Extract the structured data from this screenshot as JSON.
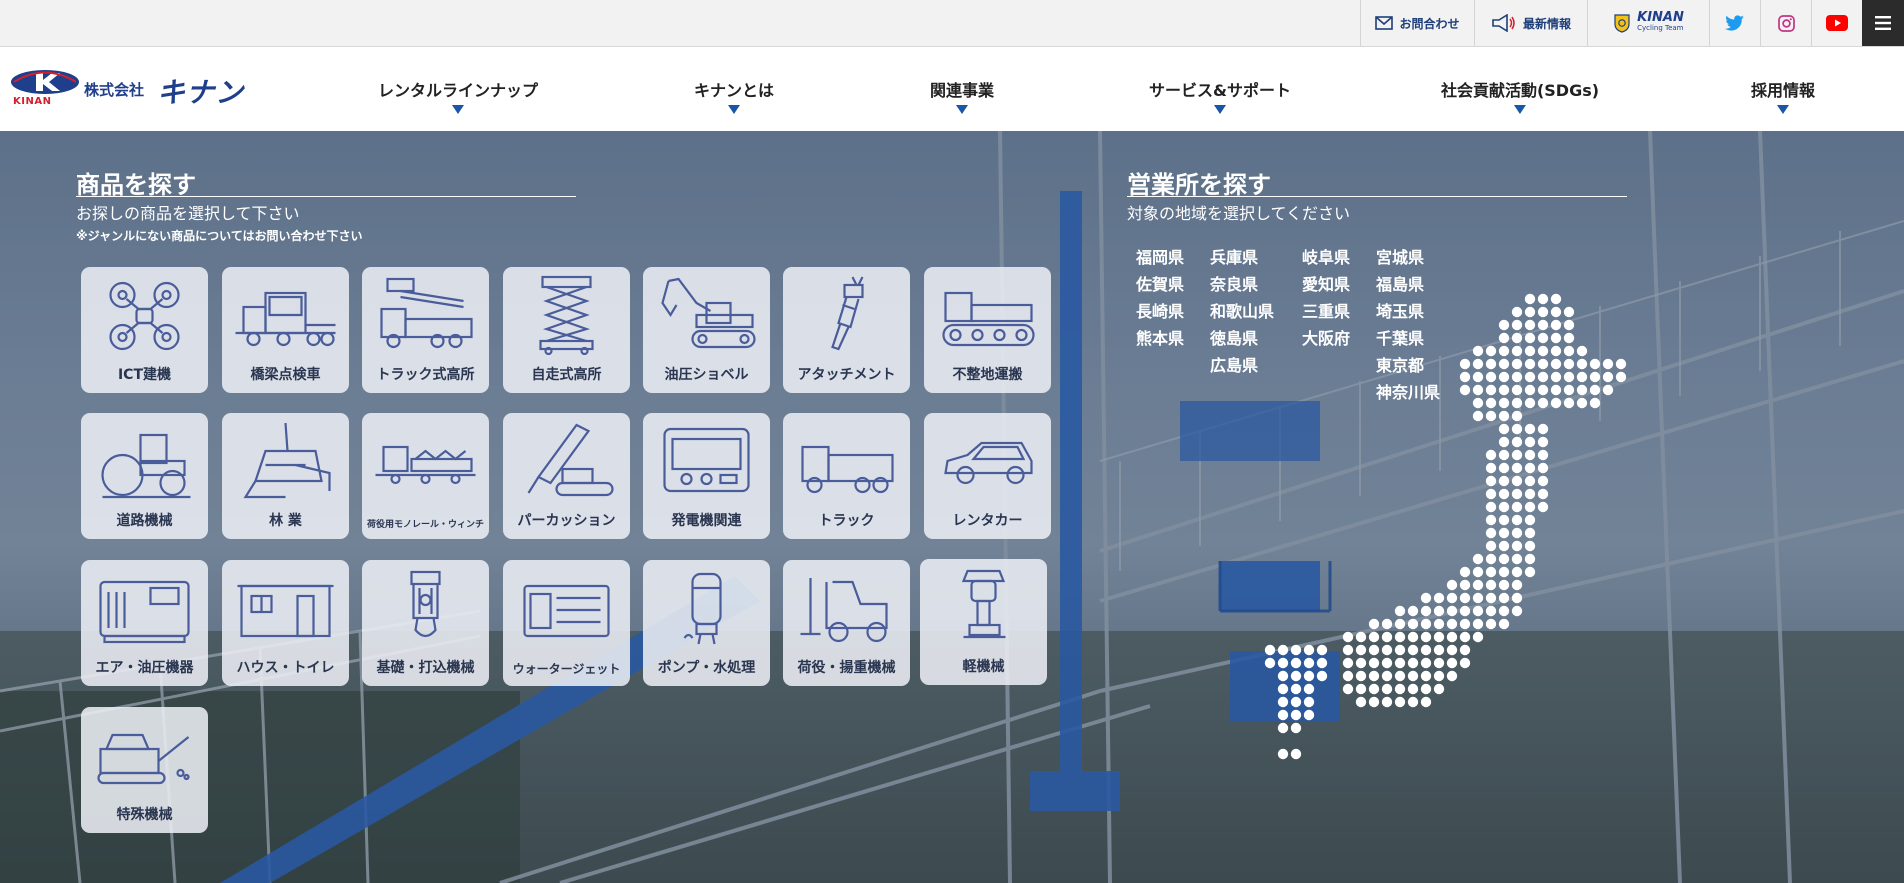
{
  "topbar": {
    "contact": "お問合わせ",
    "news": "最新情報",
    "cycling_brand": "KINAN",
    "cycling_sub": "Cycling Team",
    "icons": [
      "mail-icon",
      "megaphone-icon",
      "cycling-team-icon",
      "twitter-icon",
      "instagram-icon",
      "youtube-icon",
      "hamburger-menu-icon"
    ]
  },
  "logo": {
    "small": "KINAN",
    "company": "株式会社",
    "name": "キナン"
  },
  "nav": [
    {
      "label": "レンタルラインナップ"
    },
    {
      "label": "キナンとは"
    },
    {
      "label": "関連事業"
    },
    {
      "label": "サービス&サポート"
    },
    {
      "label": "社会貢献活動(SDGs)"
    },
    {
      "label": "採用情報"
    }
  ],
  "products": {
    "title": "商品を探す",
    "subtitle": "お探しの商品を選択して下さい",
    "note": "※ジャンルにない商品についてはお問い合わせ下さい",
    "items": [
      {
        "label": "ICT建機",
        "icon": "drone-icon"
      },
      {
        "label": "橋梁点検車",
        "icon": "bridge-inspection-truck-icon"
      },
      {
        "label": "トラック式高所",
        "icon": "aerial-truck-icon"
      },
      {
        "label": "自走式高所",
        "icon": "scissor-lift-icon"
      },
      {
        "label": "油圧ショベル",
        "icon": "excavator-icon"
      },
      {
        "label": "アタッチメント",
        "icon": "breaker-attachment-icon"
      },
      {
        "label": "不整地運搬",
        "icon": "crawler-carrier-icon"
      },
      {
        "label": "道路機械",
        "icon": "road-roller-icon"
      },
      {
        "label": "林 業",
        "icon": "forestry-machine-icon"
      },
      {
        "label": "荷役用モノレール・ウィンチ",
        "icon": "monorail-icon"
      },
      {
        "label": "パーカッション",
        "icon": "percussion-drill-icon"
      },
      {
        "label": "発電機関連",
        "icon": "generator-icon"
      },
      {
        "label": "トラック",
        "icon": "truck-icon"
      },
      {
        "label": "レンタカー",
        "icon": "car-icon"
      },
      {
        "label": "エア・油圧機器",
        "icon": "compressor-icon"
      },
      {
        "label": "ハウス・トイレ",
        "icon": "prefab-house-icon"
      },
      {
        "label": "基礎・打込機械",
        "icon": "pile-driver-icon"
      },
      {
        "label": "ウォータージェット",
        "icon": "water-jet-icon"
      },
      {
        "label": "ポンプ・水処理",
        "icon": "pump-icon"
      },
      {
        "label": "荷役・揚重機械",
        "icon": "forklift-icon"
      },
      {
        "label": "軽機械",
        "icon": "rammer-icon"
      },
      {
        "label": "特殊機械",
        "icon": "crusher-icon"
      }
    ]
  },
  "offices": {
    "title": "営業所を探す",
    "subtitle": "対象の地域を選択してください",
    "columns": [
      [
        "福岡県",
        "佐賀県",
        "長崎県",
        "熊本県"
      ],
      [
        "兵庫県",
        "奈良県",
        "和歌山県",
        "徳島県",
        "広島県"
      ],
      [
        "岐阜県",
        "愛知県",
        "三重県",
        "大阪府"
      ],
      [
        "宮城県",
        "福島県",
        "埼玉県",
        "千葉県",
        "東京都",
        "神奈川県"
      ]
    ],
    "map_icon": "japan-dot-map"
  }
}
